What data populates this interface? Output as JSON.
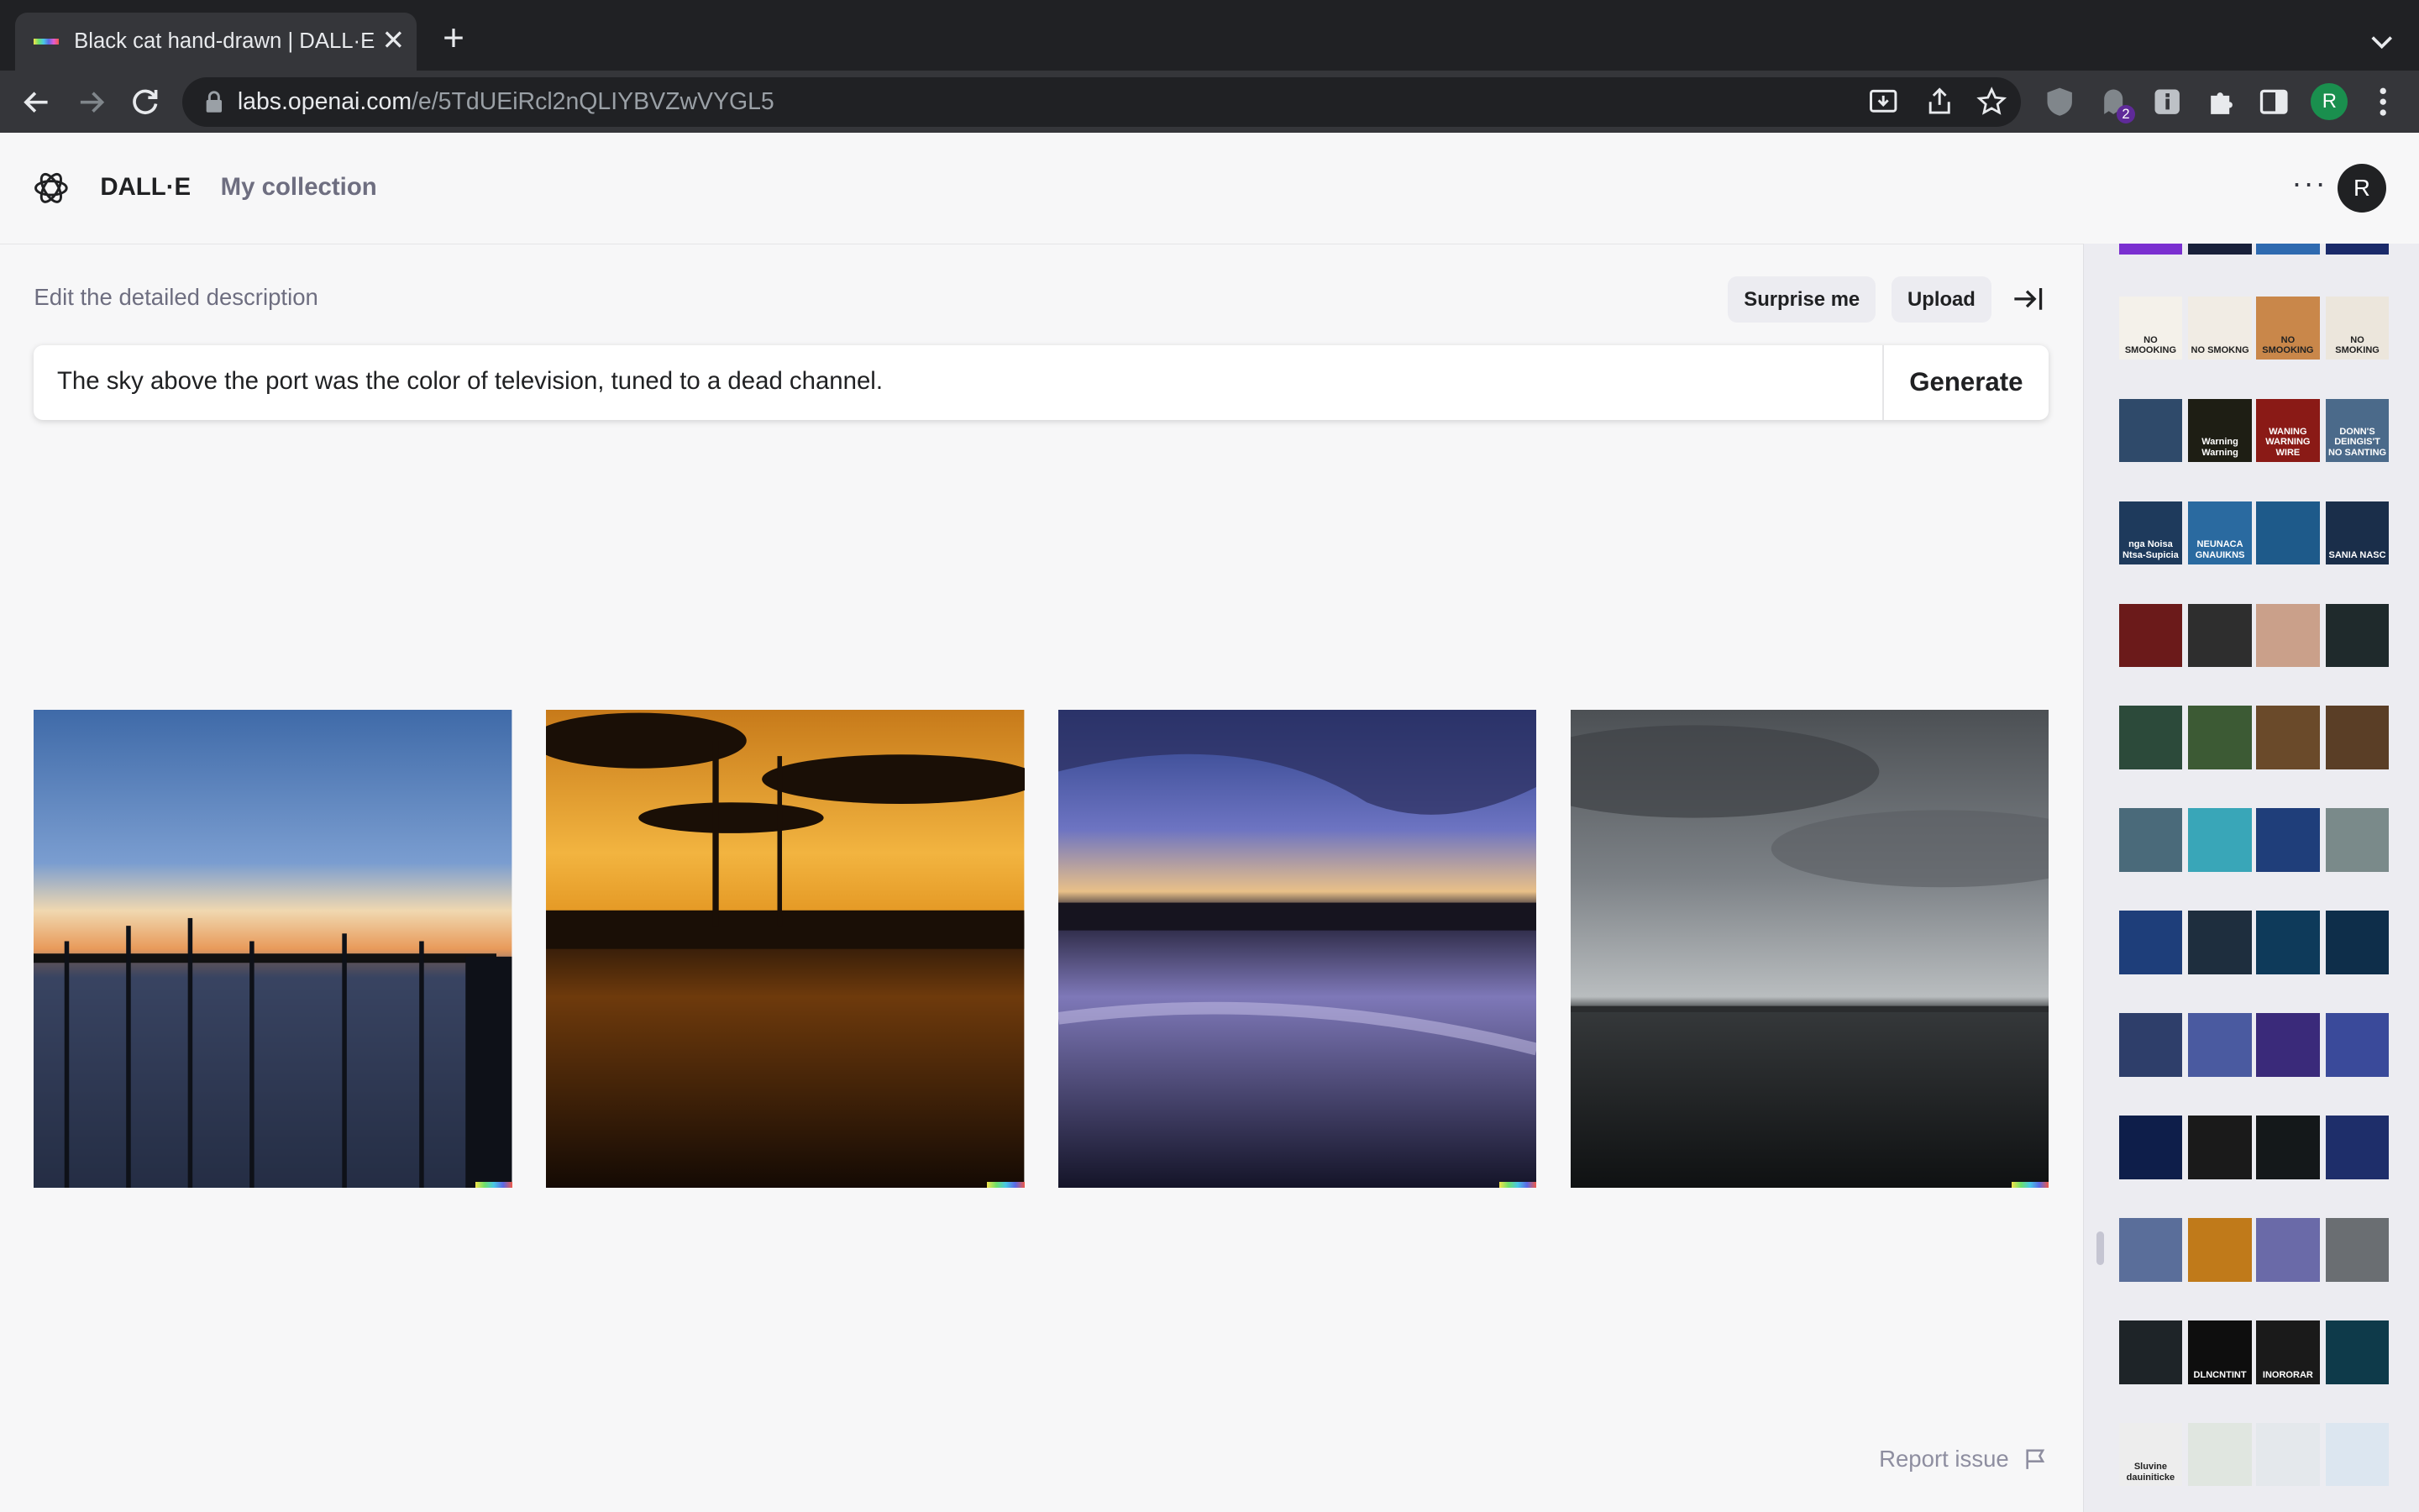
{
  "browser": {
    "tab_title": "Black cat hand-drawn | DALL·E",
    "tab_close": "✕",
    "new_tab": "+",
    "url_host": "labs.openai.com",
    "url_path": "/e/5TdUEiRcl2nQLIYBVZwVYGL5",
    "extension_badge": "2",
    "profile_initial": "R"
  },
  "header": {
    "brand": "DALL·E",
    "nav_collection": "My collection",
    "more": "···",
    "user_initial": "R"
  },
  "editor": {
    "label": "Edit the detailed description",
    "surprise_label": "Surprise me",
    "upload_label": "Upload",
    "prompt": "The sky above the port was the color of television, tuned to a dead channel.",
    "generate_label": "Generate"
  },
  "results": [
    {
      "scene": "pier at sunset, blue sky, water with posts"
    },
    {
      "scene": "orange sunset silhouette with tower"
    },
    {
      "scene": "purple dusk sky reflected in water"
    },
    {
      "scene": "overcast grey clouds over calm sea"
    }
  ],
  "footer": {
    "report_label": "Report issue"
  },
  "history": {
    "row_labels": [
      [
        "NO SMOOKING",
        "NO SMOKNG",
        "NO SMOOKING",
        "NO SMOKING"
      ],
      [
        "",
        "Warning Warning",
        "WANING WARNING WIRE",
        "DONN'S DEINGIS'T NO SANTING"
      ],
      [
        "nga Noisa Ntsa-Supicia",
        "NEUNACA GNAUIKNS",
        "",
        "SANIA NASC"
      ],
      [
        "",
        "",
        "",
        ""
      ],
      [
        "",
        "",
        "",
        ""
      ],
      [
        "",
        "",
        "",
        ""
      ],
      [
        "",
        "",
        "",
        ""
      ],
      [
        "",
        "",
        "",
        ""
      ],
      [
        "",
        "",
        "",
        ""
      ],
      [
        "",
        "",
        "",
        ""
      ],
      [
        "",
        "DLNCNTINT",
        "INORORAR",
        ""
      ],
      [
        "Sluvine dauiniticke",
        "",
        "",
        ""
      ]
    ]
  },
  "colors": {
    "accent": "#202123",
    "chrome_dark": "#202124",
    "chrome_toolbar": "#35363a",
    "page_bg": "#f7f7f8"
  }
}
